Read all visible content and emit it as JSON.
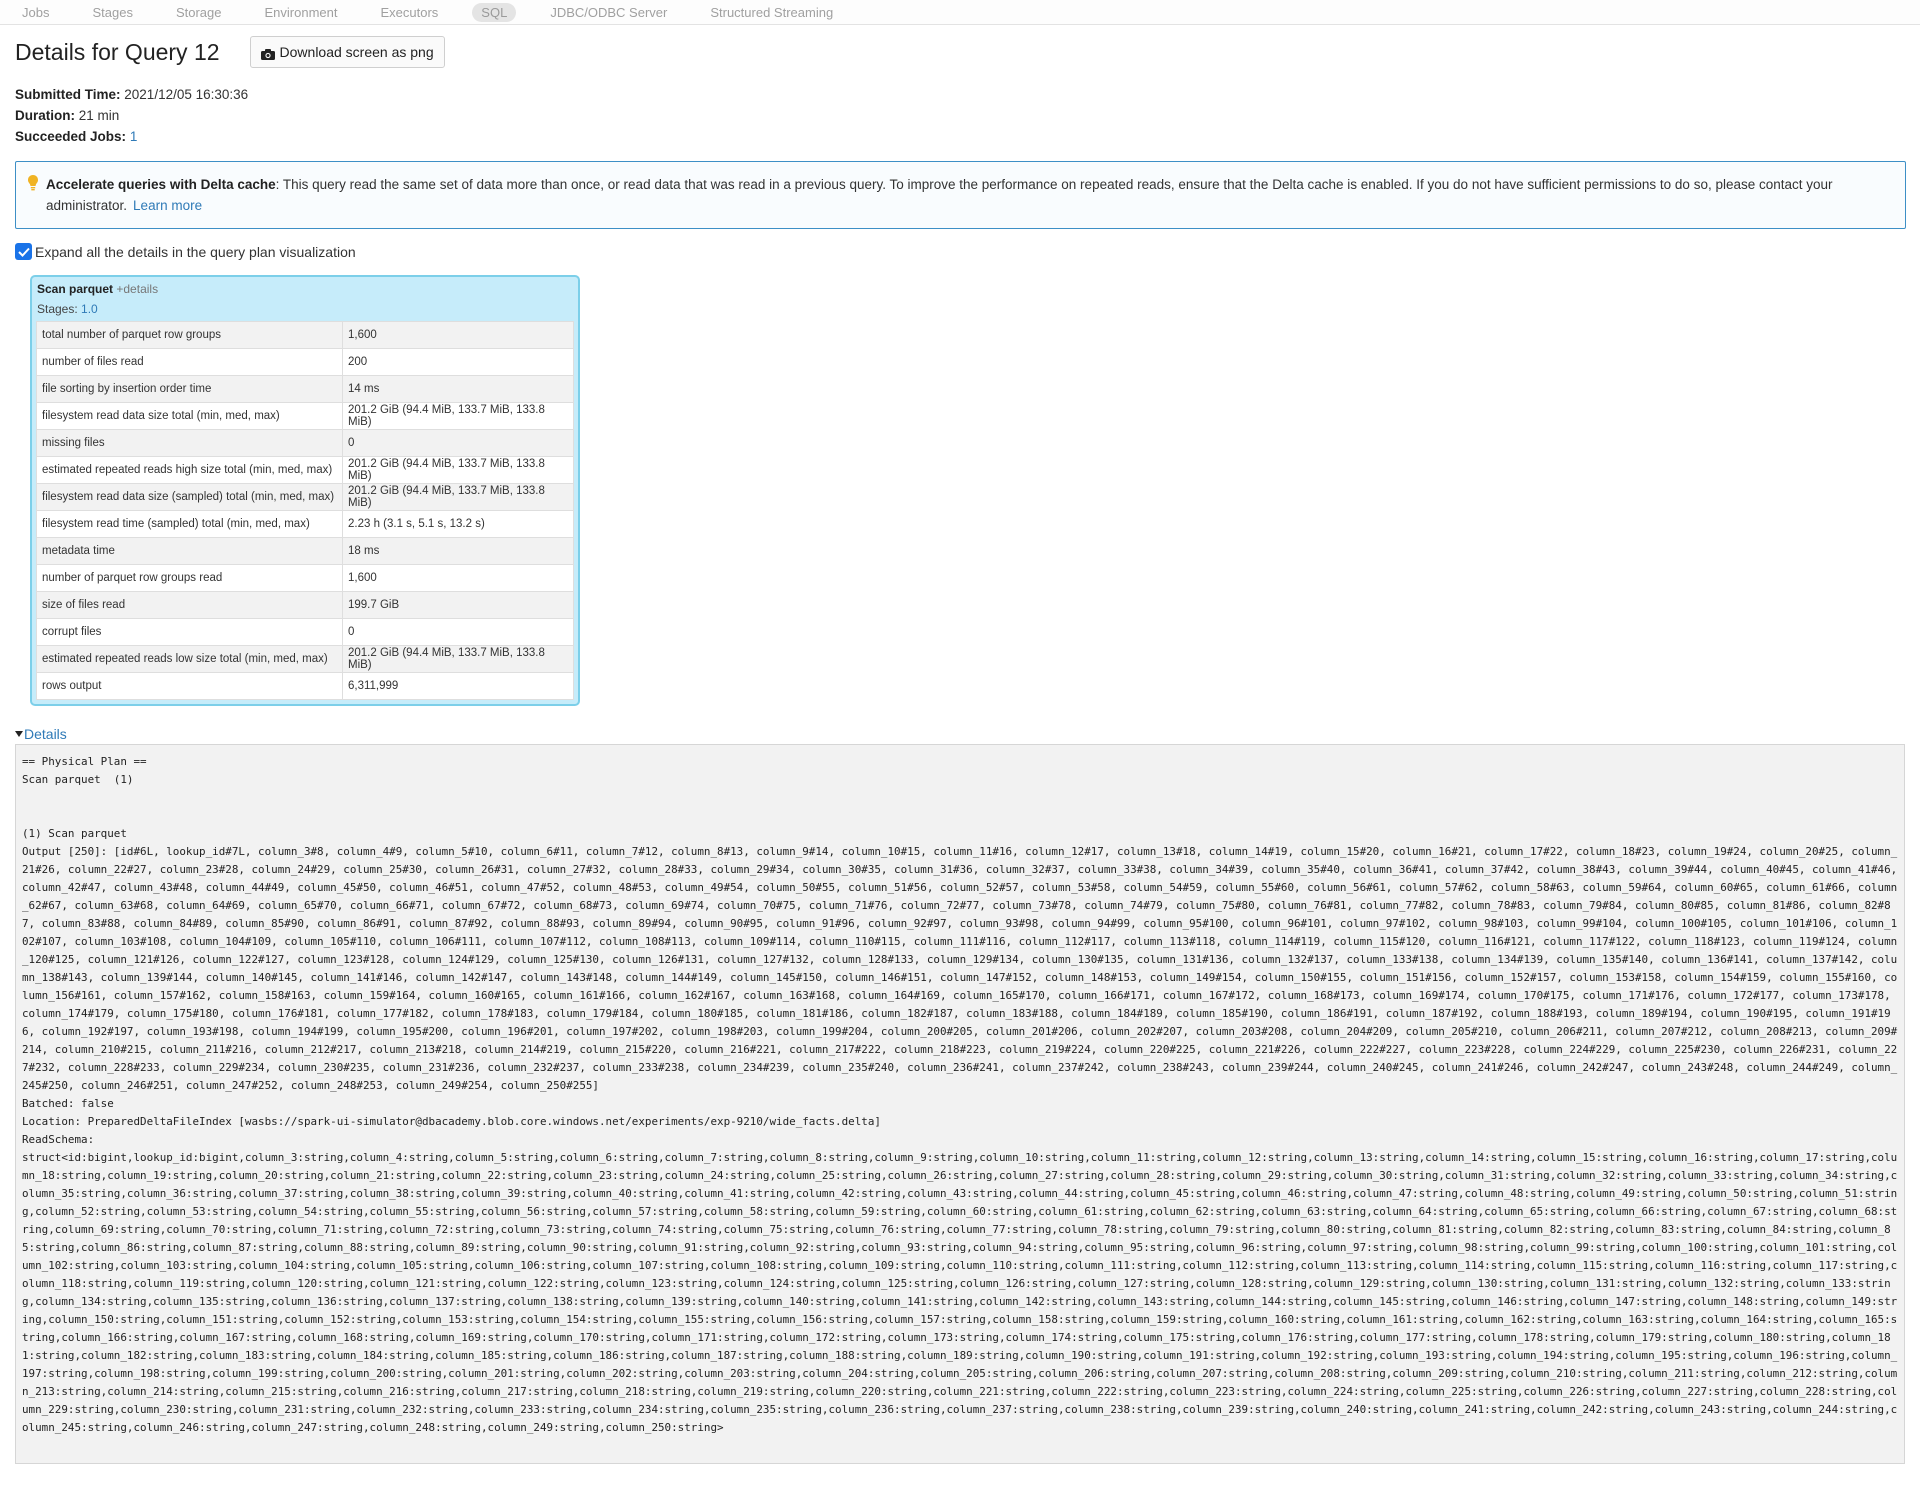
{
  "nav": {
    "items": [
      "Jobs",
      "Stages",
      "Storage",
      "Environment",
      "Executors",
      "SQL",
      "JDBC/ODBC Server",
      "Structured Streaming"
    ],
    "active": "SQL"
  },
  "page": {
    "title": "Details for Query 12",
    "download_label": "Download screen as png"
  },
  "meta": {
    "submitted_label": "Submitted Time:",
    "submitted_value": "2021/12/05 16:30:36",
    "duration_label": "Duration:",
    "duration_value": "21 min",
    "jobs_label": "Succeeded Jobs:",
    "jobs_value": "1"
  },
  "alert": {
    "bold": "Accelerate queries with Delta cache",
    "text": ": This query read the same set of data more than once, or read data that was read in a previous query. To improve the performance on repeated reads, ensure that the Delta cache is enabled. If you do not have sufficient permissions to do so, please contact your administrator.",
    "link": "Learn more",
    "accent": "#3d8fc6"
  },
  "expand": {
    "label": "Expand all the details in the query plan visualization",
    "checked": true
  },
  "node": {
    "name": "Scan parquet",
    "plus": "+details",
    "stages_label": "Stages:",
    "stages_value": "1.0",
    "metrics": [
      {
        "k": "total number of parquet row groups",
        "v": "1,600"
      },
      {
        "k": "number of files read",
        "v": "200"
      },
      {
        "k": "file sorting by insertion order time",
        "v": "14 ms"
      },
      {
        "k": "filesystem read data size total (min, med, max)",
        "v": "201.2 GiB (94.4 MiB, 133.7 MiB, 133.8 MiB)"
      },
      {
        "k": "missing files",
        "v": "0"
      },
      {
        "k": "estimated repeated reads high size total (min, med, max)",
        "v": "201.2 GiB (94.4 MiB, 133.7 MiB, 133.8 MiB)"
      },
      {
        "k": "filesystem read data size (sampled) total (min, med, max)",
        "v": "201.2 GiB (94.4 MiB, 133.7 MiB, 133.8 MiB)"
      },
      {
        "k": "filesystem read time (sampled) total (min, med, max)",
        "v": "2.23 h (3.1 s, 5.1 s, 13.2 s)"
      },
      {
        "k": "metadata time",
        "v": "18 ms"
      },
      {
        "k": "number of parquet row groups read",
        "v": "1,600"
      },
      {
        "k": "size of files read",
        "v": "199.7 GiB"
      },
      {
        "k": "corrupt files",
        "v": "0"
      },
      {
        "k": "estimated repeated reads low size total (min, med, max)",
        "v": "201.2 GiB (94.4 MiB, 133.7 MiB, 133.8 MiB)"
      },
      {
        "k": "rows output",
        "v": "6,311,999"
      }
    ]
  },
  "details": {
    "label": "Details",
    "plan_header": "== Physical Plan ==\nScan parquet  (1)\n\n\n(1) Scan parquet",
    "output_prefix": "Output [250]: [id#6L, lookup_id#7L, ",
    "batched": "Batched: false",
    "location": "Location: PreparedDeltaFileIndex [wasbs://spark-ui-simulator@dbacademy.blob.core.windows.net/experiments/exp-9210/wide_facts.delta]",
    "read_schema_label": "ReadSchema:",
    "schema_prefix": "struct<id:bigint,lookup_id:bigint,"
  }
}
